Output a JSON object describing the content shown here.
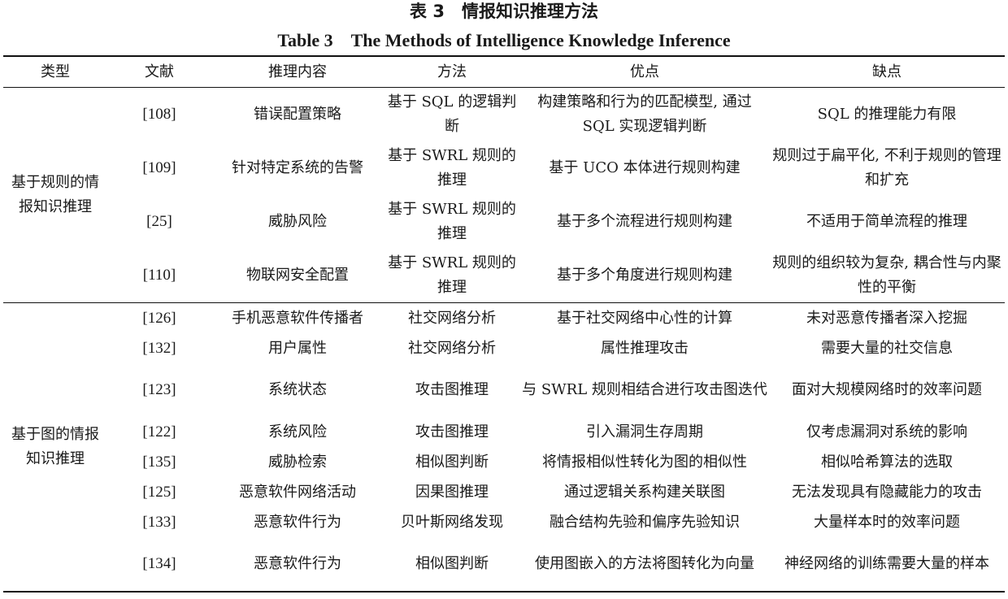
{
  "title_cn": "表 3　情报知识推理方法",
  "title_en": "Table 3　The Methods of Intelligence Knowledge Inference",
  "headers": [
    "类型",
    "文献",
    "推理内容",
    "方法",
    "优点",
    "缺点"
  ],
  "groups": [
    {
      "type": "基于规则的情报知识推理",
      "rows": [
        {
          "ref": "[108]",
          "content": "错误配置策略",
          "method": "基于 SQL 的逻辑判断",
          "pros": "构建策略和行为的匹配模型, 通过 SQL 实现逻辑判断",
          "cons": "SQL 的推理能力有限"
        },
        {
          "ref": "[109]",
          "content": "针对特定系统的告警",
          "method": "基于 SWRL 规则的推理",
          "pros": "基于 UCO 本体进行规则构建",
          "cons": "规则过于扁平化, 不利于规则的管理和扩充"
        },
        {
          "ref": "[25]",
          "content": "威胁风险",
          "method": "基于 SWRL 规则的推理",
          "pros": "基于多个流程进行规则构建",
          "cons": "不适用于简单流程的推理"
        },
        {
          "ref": "[110]",
          "content": "物联网安全配置",
          "method": "基于 SWRL 规则的推理",
          "pros": "基于多个角度进行规则构建",
          "cons": "规则的组织较为复杂, 耦合性与内聚性的平衡"
        }
      ]
    },
    {
      "type": "基于图的情报知识推理",
      "rows": [
        {
          "ref": "[126]",
          "content": "手机恶意软件传播者",
          "method": "社交网络分析",
          "pros": "基于社交网络中心性的计算",
          "cons": "未对恶意传播者深入挖掘"
        },
        {
          "ref": "[132]",
          "content": "用户属性",
          "method": "社交网络分析",
          "pros": "属性推理攻击",
          "cons": "需要大量的社交信息"
        },
        {
          "ref": "[123]",
          "content": "系统状态",
          "method": "攻击图推理",
          "pros": "与 SWRL 规则相结合进行攻击图迭代",
          "cons": "面对大规模网络时的效率问题"
        },
        {
          "ref": "[122]",
          "content": "系统风险",
          "method": "攻击图推理",
          "pros": "引入漏洞生存周期",
          "cons": "仅考虑漏洞对系统的影响"
        },
        {
          "ref": "[135]",
          "content": "威胁检索",
          "method": "相似图判断",
          "pros": "将情报相似性转化为图的相似性",
          "cons": "相似哈希算法的选取"
        },
        {
          "ref": "[125]",
          "content": "恶意软件网络活动",
          "method": "因果图推理",
          "pros": "通过逻辑关系构建关联图",
          "cons": "无法发现具有隐藏能力的攻击"
        },
        {
          "ref": "[133]",
          "content": "恶意软件行为",
          "method": "贝叶斯网络发现",
          "pros": "融合结构先验和偏序先验知识",
          "cons": "大量样本时的效率问题"
        },
        {
          "ref": "[134]",
          "content": "恶意软件行为",
          "method": "相似图判断",
          "pros": "使用图嵌入的方法将图转化为向量",
          "cons": "神经网络的训练需要大量的样本"
        }
      ]
    }
  ]
}
